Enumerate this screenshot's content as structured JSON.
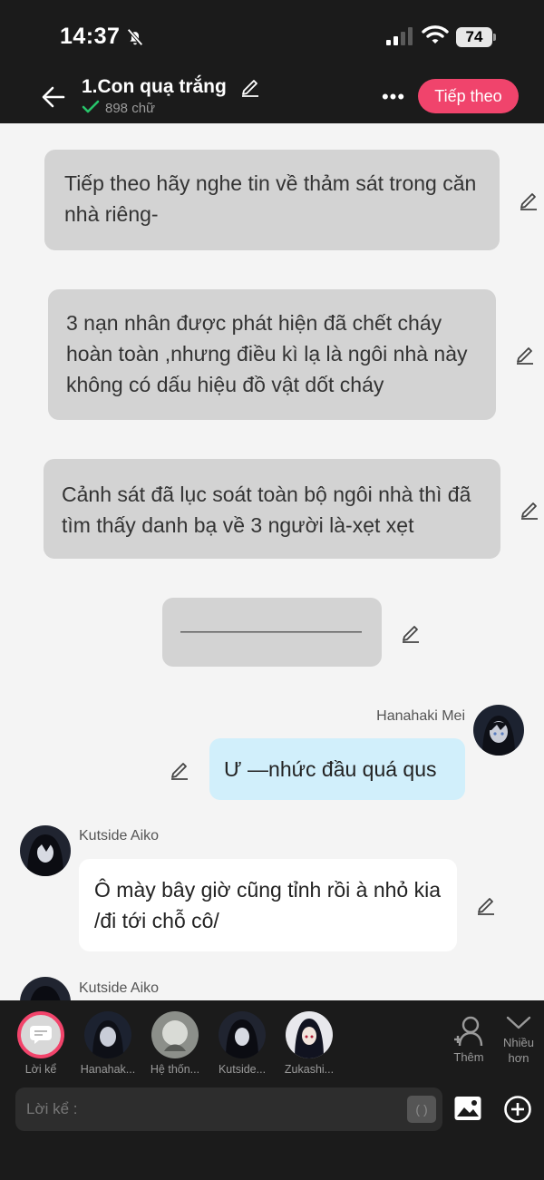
{
  "status_bar": {
    "time": "14:37",
    "battery": "74"
  },
  "header": {
    "title": "1.Con quạ trắng",
    "word_count": "898 chữ",
    "next_label": "Tiếp theo",
    "more_label": "•••"
  },
  "messages": {
    "narr1": "Tiếp theo hãy nghe tin về thảm sát trong căn nhà riêng-",
    "narr2": "3 nạn nhân được phát hiện đã chết cháy hoàn toàn ,nhưng điều kì lạ là ngôi nhà này không có dấu hiệu đồ vật dốt cháy",
    "narr3": "Cảnh sát đã lục soát toàn bộ ngôi nhà thì đã tìm thấy danh bạ về 3 người là-xẹt xẹt",
    "narr4": "——————————",
    "user_name": "Hanahaki Mei",
    "user_msg": "Ư —nhức đầu quá qus",
    "char1_name": "Kutside Aiko",
    "char1_msg": "Ô mày bây giờ cũng tỉnh rồi à nhỏ kia /đi tới chỗ cô/",
    "char2_name": "Kutside Aiko"
  },
  "bottom": {
    "characters": [
      {
        "label": "Lời kể"
      },
      {
        "label": "Hanahak..."
      },
      {
        "label": "Hệ thốn..."
      },
      {
        "label": "Kutside..."
      },
      {
        "label": "Zukashi..."
      }
    ],
    "add_label": "Thêm",
    "more_label": "Nhiều hơn",
    "input_placeholder": "Lời kể :",
    "bracket_label": "( )"
  },
  "colors": {
    "accent": "#f0446c",
    "header_bg": "#1b1b1b",
    "narration_bubble": "#d3d3d3",
    "user_bubble": "#d1effb",
    "character_bubble": "#ffffff",
    "chat_bg": "#f4f4f4"
  }
}
